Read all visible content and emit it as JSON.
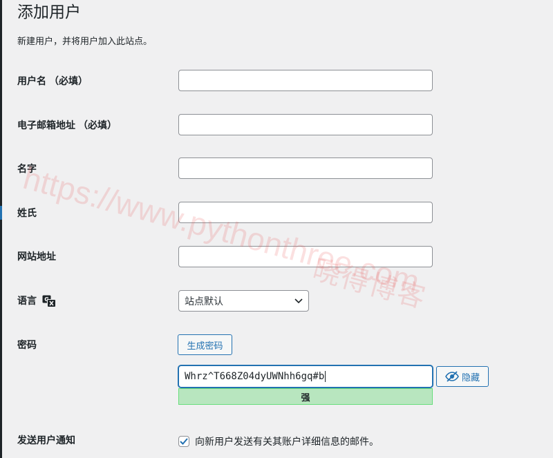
{
  "page": {
    "title": "添加用户",
    "description": "新建用户，并将用户加入此站点。"
  },
  "form": {
    "username": {
      "label": "用户名",
      "required_note": "（必填）",
      "value": ""
    },
    "email": {
      "label": "电子邮箱地址",
      "required_note": "（必填）",
      "value": ""
    },
    "first_name": {
      "label": "名字",
      "value": ""
    },
    "last_name": {
      "label": "姓氏",
      "value": ""
    },
    "website": {
      "label": "网站地址",
      "value": ""
    },
    "language": {
      "label": "语言",
      "icon": "translate-icon",
      "selected": "站点默认"
    },
    "password": {
      "label": "密码",
      "generate_button": "生成密码",
      "value": "Whrz^T668Z04dyUWNhh6gq#b",
      "hide_button": "隐藏",
      "hide_icon": "eye-slash-icon",
      "strength": "强"
    },
    "notify": {
      "label": "发送用户通知",
      "checked": true,
      "text": "向新用户发送有关其账户详细信息的邮件。"
    }
  },
  "watermark": {
    "url": "https://www.pythonthree.com",
    "name": "晓得博客"
  },
  "colors": {
    "background": "#f0f0f1",
    "accent": "#2271b1",
    "strength_bg": "#b8e6bf",
    "strength_border": "#68de7c"
  }
}
